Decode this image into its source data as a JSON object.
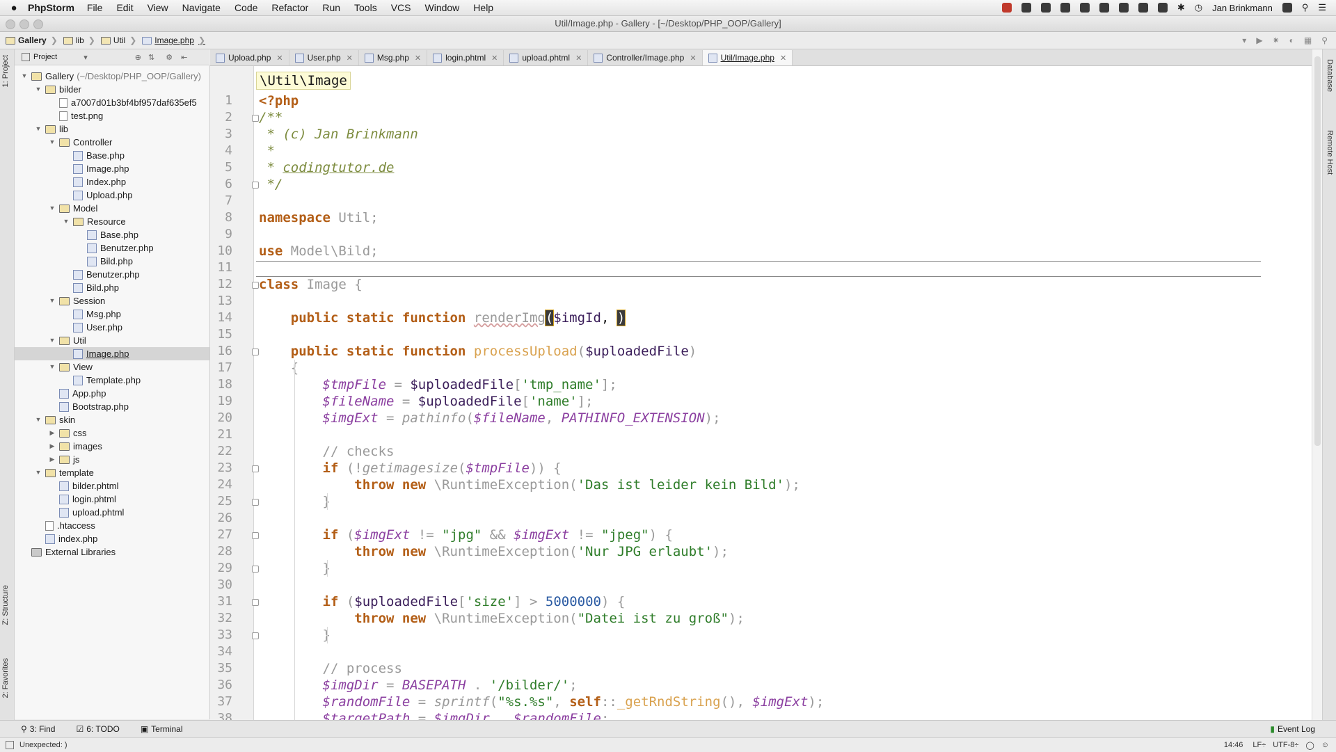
{
  "menubar": {
    "app": "PhpStorm",
    "items": [
      "File",
      "Edit",
      "View",
      "Navigate",
      "Code",
      "Refactor",
      "Run",
      "Tools",
      "VCS",
      "Window",
      "Help"
    ],
    "user": "Jan Brinkmann"
  },
  "window": {
    "title": "Util/Image.php - Gallery - [~/Desktop/PHP_OOP/Gallery]"
  },
  "breadcrumb": [
    "Gallery",
    "lib",
    "Util",
    "Image.php"
  ],
  "left_tabs": {
    "project": "1: Project",
    "structure": "Z: Structure",
    "favorites": "2: Favorites"
  },
  "right_tabs": {
    "database": "Database",
    "remote": "Remote Host"
  },
  "project_panel": {
    "label": "Project"
  },
  "tree": [
    {
      "label": "Gallery",
      "extra": "(~/Desktop/PHP_OOP/Gallery)",
      "type": "folder",
      "open": true,
      "depth": 0
    },
    {
      "label": "bilder",
      "type": "folder",
      "open": true,
      "depth": 1
    },
    {
      "label": "a7007d01b3bf4bf957daf635ef5",
      "type": "image",
      "depth": 2
    },
    {
      "label": "test.png",
      "type": "image",
      "depth": 2
    },
    {
      "label": "lib",
      "type": "folder",
      "open": true,
      "depth": 1
    },
    {
      "label": "Controller",
      "type": "folder",
      "open": true,
      "depth": 2
    },
    {
      "label": "Base.php",
      "type": "php",
      "depth": 3
    },
    {
      "label": "Image.php",
      "type": "php",
      "depth": 3
    },
    {
      "label": "Index.php",
      "type": "php",
      "depth": 3
    },
    {
      "label": "Upload.php",
      "type": "php",
      "depth": 3
    },
    {
      "label": "Model",
      "type": "folder",
      "open": true,
      "depth": 2
    },
    {
      "label": "Resource",
      "type": "folder",
      "open": true,
      "depth": 3
    },
    {
      "label": "Base.php",
      "type": "php",
      "depth": 4
    },
    {
      "label": "Benutzer.php",
      "type": "php",
      "depth": 4
    },
    {
      "label": "Bild.php",
      "type": "php",
      "depth": 4
    },
    {
      "label": "Benutzer.php",
      "type": "php",
      "depth": 3
    },
    {
      "label": "Bild.php",
      "type": "php",
      "depth": 3
    },
    {
      "label": "Session",
      "type": "folder",
      "open": true,
      "depth": 2
    },
    {
      "label": "Msg.php",
      "type": "php",
      "depth": 3
    },
    {
      "label": "User.php",
      "type": "php",
      "depth": 3
    },
    {
      "label": "Util",
      "type": "folder",
      "open": true,
      "depth": 2
    },
    {
      "label": "Image.php",
      "type": "php",
      "depth": 3,
      "selected": true
    },
    {
      "label": "View",
      "type": "folder",
      "open": true,
      "depth": 2
    },
    {
      "label": "Template.php",
      "type": "php",
      "depth": 3
    },
    {
      "label": "App.php",
      "type": "php",
      "depth": 2
    },
    {
      "label": "Bootstrap.php",
      "type": "php",
      "depth": 2
    },
    {
      "label": "skin",
      "type": "folder",
      "open": true,
      "depth": 1
    },
    {
      "label": "css",
      "type": "folder",
      "open": false,
      "depth": 2
    },
    {
      "label": "images",
      "type": "folder",
      "open": false,
      "depth": 2
    },
    {
      "label": "js",
      "type": "folder",
      "open": false,
      "depth": 2
    },
    {
      "label": "template",
      "type": "folder",
      "open": true,
      "depth": 1
    },
    {
      "label": "bilder.phtml",
      "type": "php",
      "depth": 2
    },
    {
      "label": "login.phtml",
      "type": "php",
      "depth": 2
    },
    {
      "label": "upload.phtml",
      "type": "php",
      "depth": 2
    },
    {
      "label": ".htaccess",
      "type": "image",
      "depth": 1
    },
    {
      "label": "index.php",
      "type": "php",
      "depth": 1
    },
    {
      "label": "External Libraries",
      "type": "lib",
      "depth": 0
    }
  ],
  "tabs": [
    {
      "label": "Upload.php"
    },
    {
      "label": "User.php"
    },
    {
      "label": "Msg.php"
    },
    {
      "label": "login.phtml"
    },
    {
      "label": "upload.phtml"
    },
    {
      "label": "Controller/Image.php"
    },
    {
      "label": "Util/Image.php",
      "active": true
    }
  ],
  "namespace_hint": "\\Util\\Image",
  "line_numbers": [
    "1",
    "2",
    "3",
    "4",
    "5",
    "6",
    "7",
    "8",
    "9",
    "10",
    "11",
    "12",
    "13",
    "14",
    "15",
    "16",
    "17",
    "18",
    "19",
    "20",
    "21",
    "22",
    "23",
    "24",
    "25",
    "26",
    "27",
    "28",
    "29",
    "30",
    "31",
    "32",
    "33",
    "34",
    "35",
    "36",
    "37",
    "38"
  ],
  "code": [
    [
      {
        "t": "<?php",
        "c": "kw"
      }
    ],
    [
      {
        "t": "/**",
        "c": "cm"
      }
    ],
    [
      {
        "t": " * (c) Jan Brinkmann",
        "c": "cm"
      }
    ],
    [
      {
        "t": " *",
        "c": "cm"
      }
    ],
    [
      {
        "t": " * ",
        "c": "cm"
      },
      {
        "t": "codingtutor.de",
        "c": "cmu"
      }
    ],
    [
      {
        "t": " */",
        "c": "cm"
      }
    ],
    [],
    [
      {
        "t": "namespace",
        "c": "kw"
      },
      {
        "t": " Util;",
        "c": "gr"
      }
    ],
    [],
    [
      {
        "t": "use",
        "c": "kw"
      },
      {
        "t": " Model\\Bild;",
        "c": "gr"
      }
    ],
    [],
    [
      {
        "t": "class",
        "c": "kw"
      },
      {
        "t": " Image {",
        "c": "gr"
      }
    ],
    [],
    [
      {
        "t": "    "
      },
      {
        "t": "public static function",
        "c": "kw"
      },
      {
        "t": " "
      },
      {
        "t": "renderImg",
        "c": "gr"
      },
      {
        "t": "("
      },
      {
        "t": "$imgId",
        "c": "var"
      },
      {
        "t": ", "
      },
      {
        "t": ")"
      }
    ],
    [],
    [
      {
        "t": "    "
      },
      {
        "t": "public static function",
        "c": "kw"
      },
      {
        "t": " "
      },
      {
        "t": "processUpload",
        "c": "fn"
      },
      {
        "t": "(",
        "c": "gr"
      },
      {
        "t": "$uploadedFile",
        "c": "var"
      },
      {
        "t": ")",
        "c": "gr"
      }
    ],
    [
      {
        "t": "    {",
        "c": "gr"
      }
    ],
    [
      {
        "t": "        "
      },
      {
        "t": "$tmpFile",
        "c": "ital"
      },
      {
        "t": " = ",
        "c": "gr"
      },
      {
        "t": "$uploadedFile",
        "c": "var"
      },
      {
        "t": "[",
        "c": "gr"
      },
      {
        "t": "'tmp_name'",
        "c": "st"
      },
      {
        "t": "];",
        "c": "gr"
      }
    ],
    [
      {
        "t": "        "
      },
      {
        "t": "$fileName",
        "c": "ital"
      },
      {
        "t": " = ",
        "c": "gr"
      },
      {
        "t": "$uploadedFile",
        "c": "var"
      },
      {
        "t": "[",
        "c": "gr"
      },
      {
        "t": "'name'",
        "c": "st"
      },
      {
        "t": "];",
        "c": "gr"
      }
    ],
    [
      {
        "t": "        "
      },
      {
        "t": "$imgExt",
        "c": "ital"
      },
      {
        "t": " = ",
        "c": "gr"
      },
      {
        "t": "pathinfo",
        "c": "bif"
      },
      {
        "t": "(",
        "c": "gr"
      },
      {
        "t": "$fileName",
        "c": "ital"
      },
      {
        "t": ", ",
        "c": "gr"
      },
      {
        "t": "PATHINFO_EXTENSION",
        "c": "ital"
      },
      {
        "t": ");",
        "c": "gr"
      }
    ],
    [],
    [
      {
        "t": "        "
      },
      {
        "t": "// checks",
        "c": "gr"
      }
    ],
    [
      {
        "t": "        "
      },
      {
        "t": "if",
        "c": "kw"
      },
      {
        "t": " (!",
        "c": "gr"
      },
      {
        "t": "getimagesize",
        "c": "bif"
      },
      {
        "t": "(",
        "c": "gr"
      },
      {
        "t": "$tmpFile",
        "c": "ital"
      },
      {
        "t": ")) {",
        "c": "gr"
      }
    ],
    [
      {
        "t": "            "
      },
      {
        "t": "throw new",
        "c": "kw"
      },
      {
        "t": " \\RuntimeException(",
        "c": "gr"
      },
      {
        "t": "'Das ist leider kein Bild'",
        "c": "st"
      },
      {
        "t": ");",
        "c": "gr"
      }
    ],
    [
      {
        "t": "        }",
        "c": "gr"
      }
    ],
    [],
    [
      {
        "t": "        "
      },
      {
        "t": "if",
        "c": "kw"
      },
      {
        "t": " (",
        "c": "gr"
      },
      {
        "t": "$imgExt",
        "c": "ital"
      },
      {
        "t": " != ",
        "c": "gr"
      },
      {
        "t": "\"jpg\"",
        "c": "st"
      },
      {
        "t": " && ",
        "c": "gr"
      },
      {
        "t": "$imgExt",
        "c": "ital"
      },
      {
        "t": " != ",
        "c": "gr"
      },
      {
        "t": "\"jpeg\"",
        "c": "st"
      },
      {
        "t": ") {",
        "c": "gr"
      }
    ],
    [
      {
        "t": "            "
      },
      {
        "t": "throw new",
        "c": "kw"
      },
      {
        "t": " \\RuntimeException(",
        "c": "gr"
      },
      {
        "t": "'Nur JPG erlaubt'",
        "c": "st"
      },
      {
        "t": ");",
        "c": "gr"
      }
    ],
    [
      {
        "t": "        }",
        "c": "gr"
      }
    ],
    [],
    [
      {
        "t": "        "
      },
      {
        "t": "if",
        "c": "kw"
      },
      {
        "t": " (",
        "c": "gr"
      },
      {
        "t": "$uploadedFile",
        "c": "var"
      },
      {
        "t": "[",
        "c": "gr"
      },
      {
        "t": "'size'",
        "c": "st"
      },
      {
        "t": "] > ",
        "c": "gr"
      },
      {
        "t": "5000000",
        "c": "nm"
      },
      {
        "t": ") {",
        "c": "gr"
      }
    ],
    [
      {
        "t": "            "
      },
      {
        "t": "throw new",
        "c": "kw"
      },
      {
        "t": " \\RuntimeException(",
        "c": "gr"
      },
      {
        "t": "\"Datei ist zu groß\"",
        "c": "st"
      },
      {
        "t": ");",
        "c": "gr"
      }
    ],
    [
      {
        "t": "        }",
        "c": "gr"
      }
    ],
    [],
    [
      {
        "t": "        "
      },
      {
        "t": "// process",
        "c": "gr"
      }
    ],
    [
      {
        "t": "        "
      },
      {
        "t": "$imgDir",
        "c": "ital"
      },
      {
        "t": " = ",
        "c": "gr"
      },
      {
        "t": "BASEPATH",
        "c": "ital"
      },
      {
        "t": " . ",
        "c": "gr"
      },
      {
        "t": "'/bilder/'",
        "c": "st"
      },
      {
        "t": ";",
        "c": "gr"
      }
    ],
    [
      {
        "t": "        "
      },
      {
        "t": "$randomFile",
        "c": "ital"
      },
      {
        "t": " = ",
        "c": "gr"
      },
      {
        "t": "sprintf",
        "c": "bif"
      },
      {
        "t": "(",
        "c": "gr"
      },
      {
        "t": "\"%s.%s\"",
        "c": "st"
      },
      {
        "t": ", ",
        "c": "gr"
      },
      {
        "t": "self",
        "c": "kw"
      },
      {
        "t": "::",
        "c": "gr"
      },
      {
        "t": "_getRndString",
        "c": "fn"
      },
      {
        "t": "(), ",
        "c": "gr"
      },
      {
        "t": "$imgExt",
        "c": "ital"
      },
      {
        "t": ");",
        "c": "gr"
      }
    ],
    [
      {
        "t": "        "
      },
      {
        "t": "$targetPath",
        "c": "ital"
      },
      {
        "t": " = ",
        "c": "gr"
      },
      {
        "t": "$imgDir",
        "c": "ital"
      },
      {
        "t": " . ",
        "c": "gr"
      },
      {
        "t": "$randomFile",
        "c": "ital"
      },
      {
        "t": ";",
        "c": "gr"
      }
    ]
  ],
  "toolwindows": {
    "find": "3: Find",
    "todo": "6: TODO",
    "terminal": "Terminal",
    "event_log": "Event Log"
  },
  "status": {
    "message": "Unexpected: )",
    "time": "14:46",
    "line_sep": "LF÷",
    "encoding": "UTF-8÷"
  }
}
